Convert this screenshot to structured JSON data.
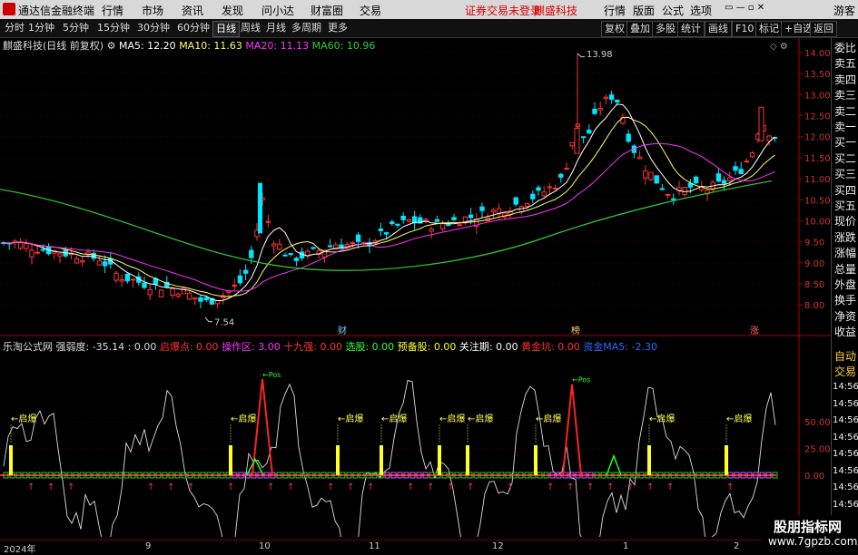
{
  "menu": {
    "app_title": "通达信金融终端",
    "items": [
      "行情",
      "市场",
      "资讯",
      "发现",
      "问小达",
      "财富圈",
      "交易"
    ],
    "warning": "证券交易未登录",
    "stock_name": "麒盛科技",
    "right_items": [
      "行情",
      "版面",
      "公式",
      "选项"
    ],
    "guest": "游客"
  },
  "toolbar": {
    "periods": [
      "分时",
      "1分钟",
      "5分钟",
      "15分钟",
      "30分钟",
      "60分钟",
      "日线",
      "周线",
      "月线",
      "多周期",
      "更多"
    ],
    "active_period": "日线",
    "right_buttons": [
      "复权",
      "叠加",
      "多股",
      "统计",
      "画线",
      "F10",
      "标记",
      "+自选",
      "返回"
    ]
  },
  "main_legend": {
    "title": "麒盛科技(日线 前复权)",
    "ma5": "MA5: 12.20",
    "ma10": "MA10: 11.63",
    "ma20": "MA20: 11.13",
    "ma60": "MA60: 10.96"
  },
  "indicator_legend": {
    "title": "乐淘公式网 强弱度: -35.14 : 0.00",
    "qibao": "启爆点: 0.00",
    "caozuo": "操作区: 3.00",
    "shijiu": "十九强: 0.00",
    "xuangu": "选股: 0.00",
    "yubei": "预备股: 0.00",
    "guanzhu": "关注期: 0.00",
    "huangjin": "黄金坑: 0.00",
    "ma5": "资金MA5: -2.30"
  },
  "price_axis": [
    "14.00",
    "13.50",
    "13.00",
    "12.50",
    "12.00",
    "11.50",
    "11.00",
    "10.50",
    "10.00",
    "9.50",
    "9.00",
    "8.50",
    "8.00"
  ],
  "indicator_axis": [
    "50.00",
    "25.00",
    "0.00"
  ],
  "annotations": {
    "high": "13.98",
    "low": "7.54",
    "qibao_label": "启爆",
    "event_cai": "财",
    "event_bang": "榜",
    "event_zhang": "涨",
    "peak_label": "Pos"
  },
  "right_panel": [
    "委比",
    "卖五",
    "卖四",
    "卖三",
    "卖二",
    "卖一",
    "买一",
    "买二",
    "买三",
    "买四",
    "买五",
    "现价",
    "涨跌",
    "涨幅",
    "总量",
    "外盘",
    "换手",
    "净资",
    "收益"
  ],
  "right_panel_lower": [
    "自动",
    "交易"
  ],
  "right_panel_times": [
    "14:56",
    "14:56",
    "14:56",
    "14:56",
    "14:56",
    "14:56",
    "14:56",
    "14:56"
  ],
  "x_axis": [
    "2024年",
    "9",
    "10",
    "11",
    "12",
    "1",
    "2"
  ],
  "watermark": {
    "line1": "股朋指标网",
    "line2": "www.7gpzb.com"
  },
  "colors": {
    "up": "#ff3333",
    "down": "#00e5ff",
    "ma5": "#ffffff",
    "ma10": "#ffff66",
    "ma20": "#ff33ff",
    "ma60": "#33cc33",
    "accent": "#ff0000"
  }
}
